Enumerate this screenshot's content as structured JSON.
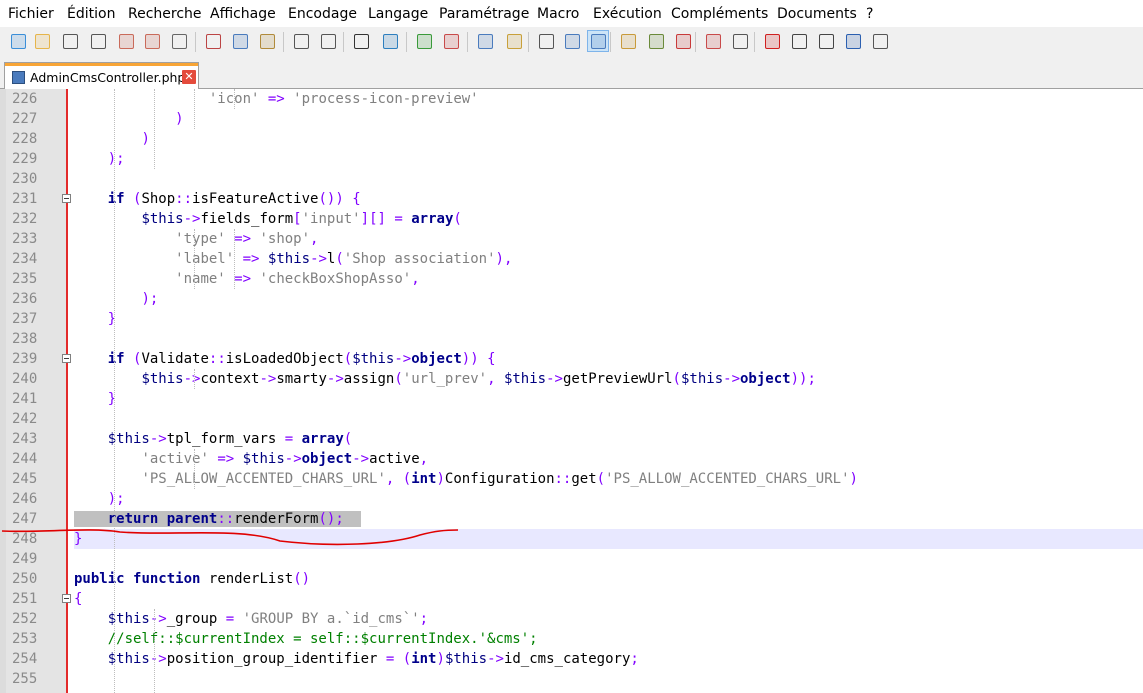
{
  "menu": [
    "Fichier",
    "Édition",
    "Recherche",
    "Affichage",
    "Encodage",
    "Langage",
    "Paramétrage",
    "Macro",
    "Exécution",
    "Compléments",
    "Documents",
    "?"
  ],
  "toolbar": {
    "icons": [
      {
        "name": "new-file-icon"
      },
      {
        "name": "open-file-icon"
      },
      {
        "name": "save-icon"
      },
      {
        "name": "save-all-icon"
      },
      {
        "name": "close-file-icon"
      },
      {
        "name": "close-all-icon"
      },
      {
        "name": "print-icon"
      },
      {
        "name": "cut-icon"
      },
      {
        "name": "copy-icon"
      },
      {
        "name": "paste-icon"
      },
      {
        "name": "undo-icon"
      },
      {
        "name": "redo-icon"
      },
      {
        "name": "find-icon"
      },
      {
        "name": "replace-icon"
      },
      {
        "name": "zoom-in-icon"
      },
      {
        "name": "zoom-out-icon"
      },
      {
        "name": "sync-vertical-icon"
      },
      {
        "name": "sync-horizontal-icon"
      },
      {
        "name": "word-wrap-icon"
      },
      {
        "name": "show-all-chars-icon"
      },
      {
        "name": "indent-guide-icon"
      },
      {
        "name": "user-language-icon"
      },
      {
        "name": "doc-map-icon"
      },
      {
        "name": "function-list-icon"
      },
      {
        "name": "folder-workspace-icon"
      },
      {
        "name": "monitoring-icon"
      },
      {
        "name": "record-macro-icon"
      },
      {
        "name": "stop-macro-icon"
      },
      {
        "name": "play-macro-icon"
      },
      {
        "name": "run-macro-multiple-icon"
      },
      {
        "name": "save-macro-icon"
      }
    ]
  },
  "tab": {
    "label": "AdminCmsController.php",
    "close": "✕"
  },
  "editor": {
    "current_line": 248,
    "lines": [
      {
        "n": "226",
        "t": "                'icon' => 'process-icon-preview'"
      },
      {
        "n": "227",
        "t": "            )"
      },
      {
        "n": "228",
        "t": "        )"
      },
      {
        "n": "229",
        "t": "    );"
      },
      {
        "n": "230",
        "t": ""
      },
      {
        "n": "231",
        "t": "    if (Shop::isFeatureActive()) {"
      },
      {
        "n": "232",
        "t": "        $this->fields_form['input'][] = array("
      },
      {
        "n": "233",
        "t": "            'type' => 'shop',"
      },
      {
        "n": "234",
        "t": "            'label' => $this->l('Shop association'),"
      },
      {
        "n": "235",
        "t": "            'name' => 'checkBoxShopAsso',"
      },
      {
        "n": "236",
        "t": "        );"
      },
      {
        "n": "237",
        "t": "    }"
      },
      {
        "n": "238",
        "t": ""
      },
      {
        "n": "239",
        "t": "    if (Validate::isLoadedObject($this->object)) {"
      },
      {
        "n": "240",
        "t": "        $this->context->smarty->assign('url_prev', $this->getPreviewUrl($this->object));"
      },
      {
        "n": "241",
        "t": "    }"
      },
      {
        "n": "242",
        "t": ""
      },
      {
        "n": "243",
        "t": "    $this->tpl_form_vars = array("
      },
      {
        "n": "244",
        "t": "        'active' => $this->object->active,"
      },
      {
        "n": "245",
        "t": "        'PS_ALLOW_ACCENTED_CHARS_URL', (int)Configuration::get('PS_ALLOW_ACCENTED_CHARS_URL')"
      },
      {
        "n": "246",
        "t": "    );"
      },
      {
        "n": "247",
        "t": "    return parent::renderForm();"
      },
      {
        "n": "248",
        "t": "}"
      },
      {
        "n": "249",
        "t": ""
      },
      {
        "n": "250",
        "t": "public function renderList()"
      },
      {
        "n": "251",
        "t": "{"
      },
      {
        "n": "252",
        "t": "    $this->_group = 'GROUP BY a.`id_cms`';"
      },
      {
        "n": "253",
        "t": "    //self::$currentIndex = self::$currentIndex.'&cms';"
      },
      {
        "n": "254",
        "t": "    $this->position_group_identifier = (int)$this->id_cms_category;"
      },
      {
        "n": "255",
        "t": ""
      }
    ],
    "fold_markers": [
      "231",
      "239",
      "251"
    ]
  },
  "colors": {
    "keyword": "#00008b",
    "variable": "#000080",
    "string": "#808080",
    "operator": "#8000ff",
    "comment": "#008000",
    "annotation": "#e00000"
  }
}
